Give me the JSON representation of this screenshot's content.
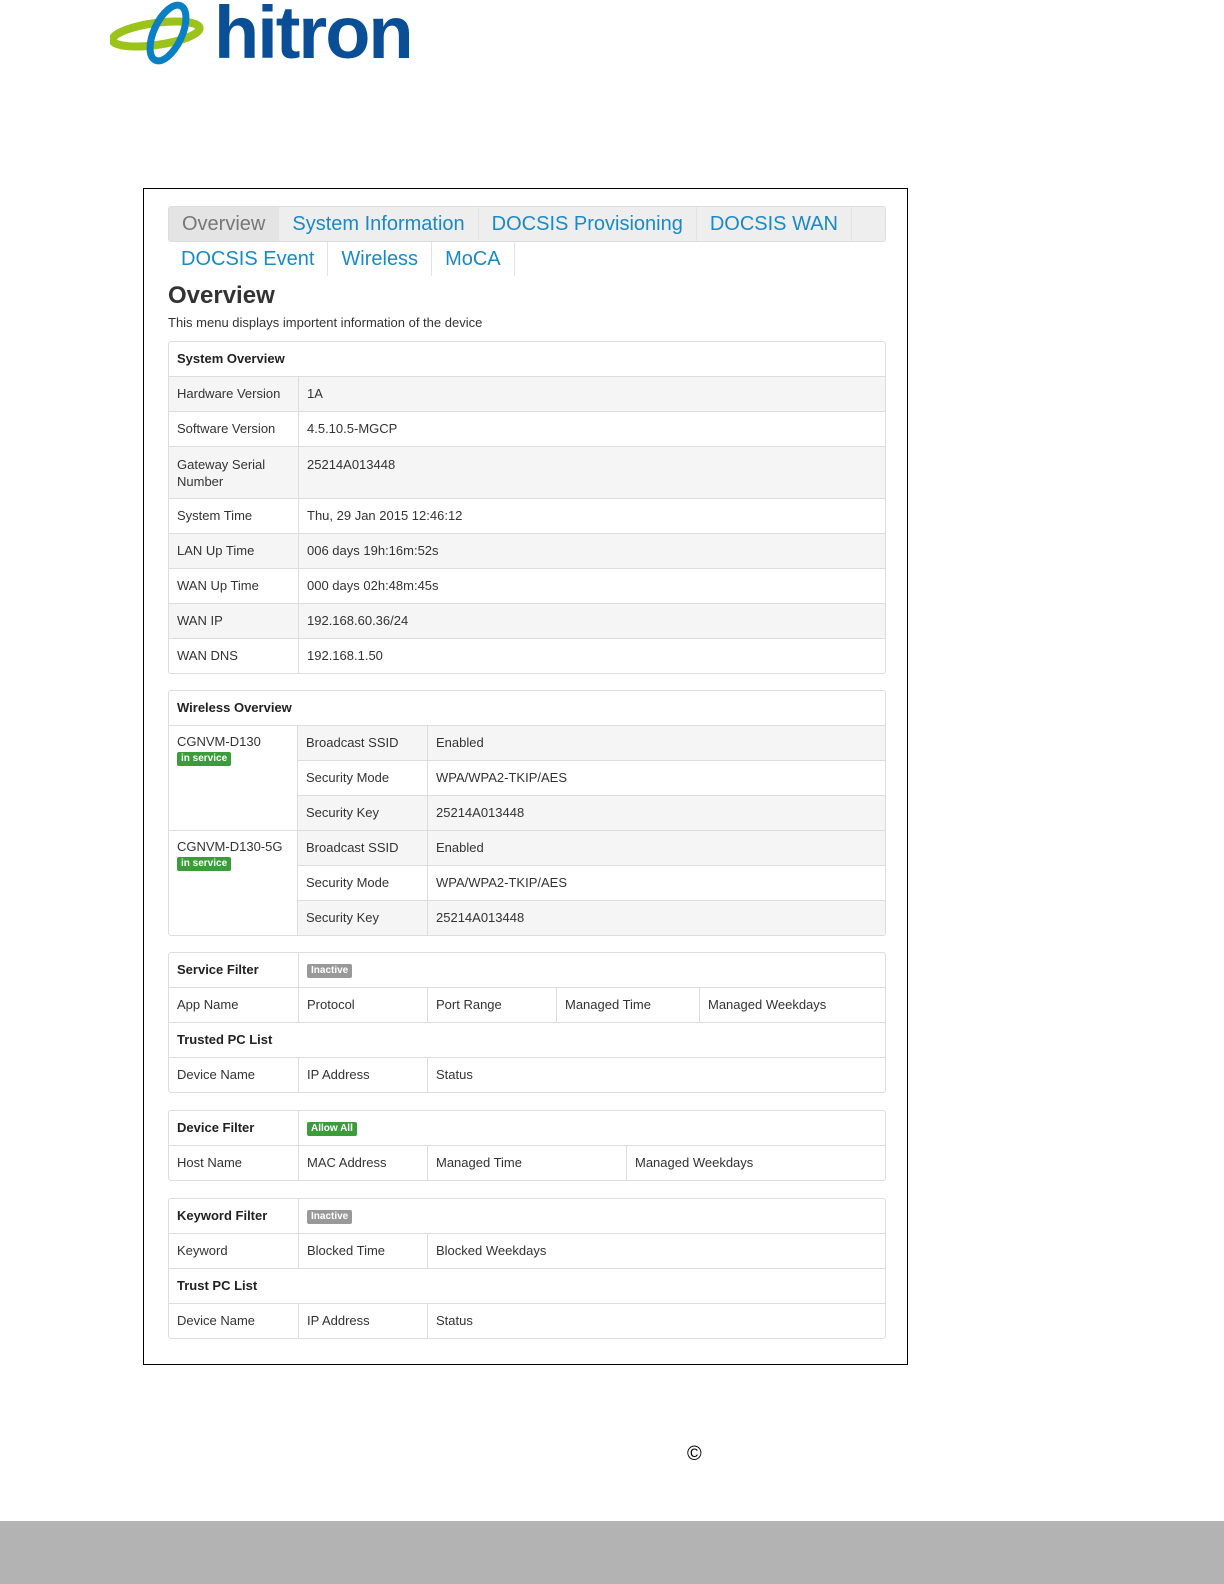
{
  "brand": {
    "logo_text": "hitron"
  },
  "tabs": [
    "Overview",
    "System Information",
    "DOCSIS Provisioning",
    "DOCSIS WAN",
    "DOCSIS Event",
    "Wireless",
    "MoCA"
  ],
  "page": {
    "title": "Overview",
    "subtitle": "This menu displays importent information of the device"
  },
  "system_overview": {
    "header": "System Overview",
    "rows": [
      {
        "label": "Hardware Version",
        "value": "1A"
      },
      {
        "label": "Software Version",
        "value": "4.5.10.5-MGCP"
      },
      {
        "label": "Gateway Serial Number",
        "value": "25214A013448"
      },
      {
        "label": "System Time",
        "value": "Thu, 29 Jan 2015 12:46:12"
      },
      {
        "label": "LAN Up Time",
        "value": "006 days 19h:16m:52s"
      },
      {
        "label": "WAN Up Time",
        "value": "000 days 02h:48m:45s"
      },
      {
        "label": "WAN IP",
        "value": "192.168.60.36/24"
      },
      {
        "label": "WAN DNS",
        "value": "192.168.1.50"
      }
    ]
  },
  "wireless_overview": {
    "header": "Wireless Overview",
    "networks": [
      {
        "name": "CGNVM-D130",
        "badge": "in service",
        "rows": [
          {
            "label": "Broadcast SSID",
            "value": "Enabled"
          },
          {
            "label": "Security Mode",
            "value": "WPA/WPA2-TKIP/AES"
          },
          {
            "label": "Security Key",
            "value": "25214A013448"
          }
        ]
      },
      {
        "name": "CGNVM-D130-5G",
        "badge": "in service",
        "rows": [
          {
            "label": "Broadcast SSID",
            "value": "Enabled"
          },
          {
            "label": "Security Mode",
            "value": "WPA/WPA2-TKIP/AES"
          },
          {
            "label": "Security Key",
            "value": "25214A013448"
          }
        ]
      }
    ]
  },
  "service_filter": {
    "header": "Service Filter",
    "badge": "Inactive",
    "columns": [
      "App Name",
      "Protocol",
      "Port Range",
      "Managed Time",
      "Managed Weekdays"
    ],
    "trusted_header": "Trusted PC List",
    "trusted_columns": [
      "Device Name",
      "IP Address",
      "Status"
    ]
  },
  "device_filter": {
    "header": "Device Filter",
    "badge": "Allow All",
    "columns": [
      "Host Name",
      "MAC Address",
      "Managed Time",
      "Managed Weekdays"
    ]
  },
  "keyword_filter": {
    "header": "Keyword Filter",
    "badge": "Inactive",
    "columns": [
      "Keyword",
      "Blocked Time",
      "Blocked Weekdays"
    ],
    "trusted_header": "Trust PC List",
    "trusted_columns": [
      "Device Name",
      "IP Address",
      "Status"
    ]
  },
  "footer": {
    "copyright_symbol": "©"
  },
  "colors": {
    "accent": "#1a8ac6",
    "brand": "#0a4f96",
    "badge_green": "#3a9d3a",
    "badge_gray": "#999999"
  }
}
